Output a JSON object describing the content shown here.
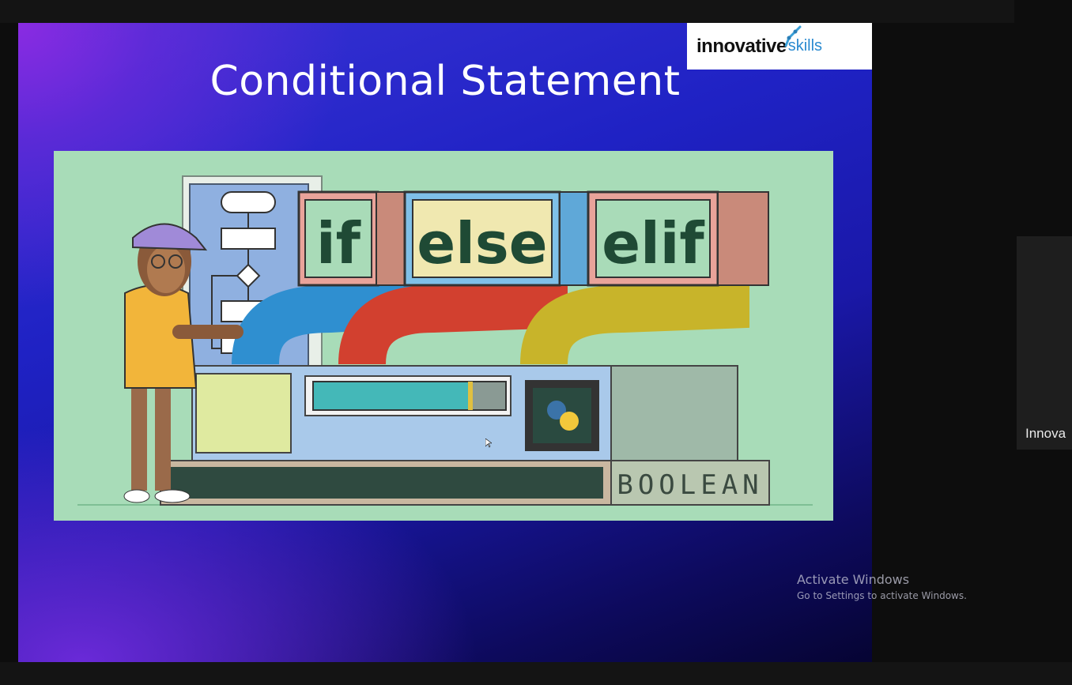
{
  "slide": {
    "title": "Conditional Statement",
    "logo": {
      "part1": "innovative",
      "part2": "skills"
    },
    "illustration": {
      "labels": {
        "if": "if",
        "else": "else",
        "elif": "elif",
        "boolean": "BOOLEAN"
      }
    }
  },
  "participant": {
    "name": "Innova"
  },
  "watermark": {
    "line1": "Activate Windows",
    "line2": "Go to Settings to activate Windows."
  },
  "colors": {
    "slide_gradient_start": "#8a2be2",
    "slide_gradient_mid": "#1f22c4",
    "slide_gradient_end": "#060433",
    "illustration_bg": "#a8dcb8",
    "wire_blue": "#2f8fd0",
    "wire_red": "#d2402f",
    "wire_yellow": "#c8b42a"
  }
}
